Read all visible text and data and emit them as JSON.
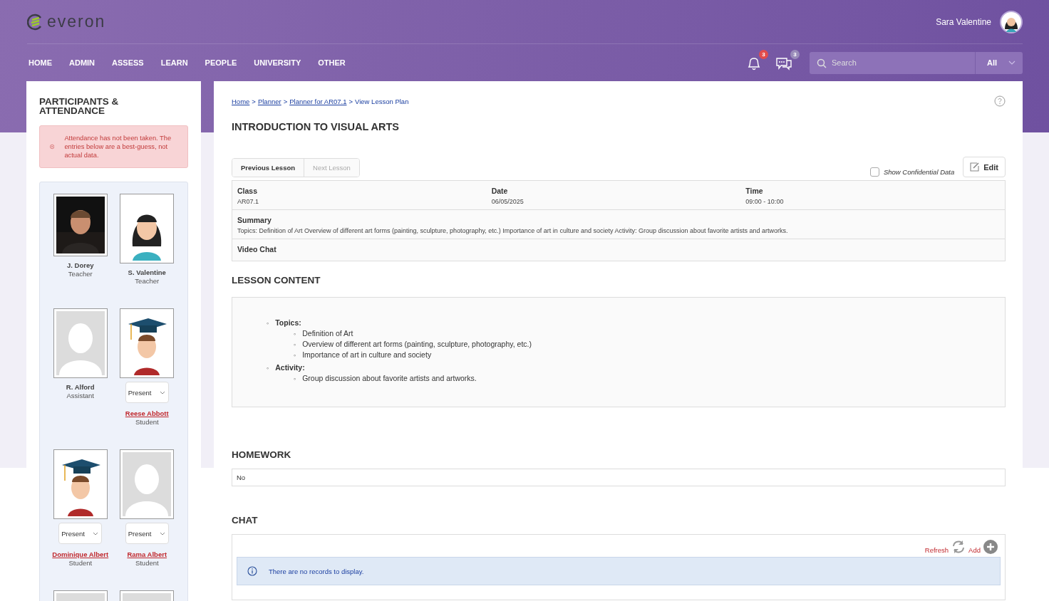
{
  "header": {
    "brand": "everon",
    "user_name": "Sara Valentine",
    "nav": [
      {
        "label": "HOME"
      },
      {
        "label": "ADMIN"
      },
      {
        "label": "ASSESS"
      },
      {
        "label": "LEARN"
      },
      {
        "label": "PEOPLE"
      },
      {
        "label": "UNIVERSITY"
      },
      {
        "label": "OTHER"
      }
    ],
    "notifications": "3",
    "messages": "3",
    "search": {
      "placeholder": "Search",
      "scope": "All"
    }
  },
  "participants": {
    "title": "PARTICIPANTS & ATTENDANCE",
    "alert": "Attendance has not been taken. The entries below are a best-guess, not actual data.",
    "people": [
      {
        "name": "J. Dorey",
        "role": "Teacher",
        "link": false
      },
      {
        "kind": "illustration",
        "name": "S. Valentine",
        "role": "Teacher",
        "link": false
      },
      {
        "kind": "placeholder",
        "name": "R. Alford",
        "role": "Assistant",
        "link": false
      },
      {
        "kind": "graduate",
        "attendance": "Present",
        "name": "Reese Abbott",
        "role": "Student",
        "link": true
      },
      {
        "kind": "graduate",
        "attendance": "Present",
        "name": "Dominique Albert",
        "role": "Student",
        "link": true
      },
      {
        "kind": "placeholder",
        "attendance": "Present",
        "name": "Rama Albert",
        "role": "Student",
        "link": true
      },
      {
        "kind": "placeholder"
      },
      {
        "kind": "placeholder"
      }
    ]
  },
  "main": {
    "breadcrumb": {
      "separator": ">",
      "links": [
        "Home",
        "Planner",
        "Planner for AR07.1"
      ],
      "current": "View Lesson Plan"
    },
    "title": "INTRODUCTION TO VISUAL ARTS",
    "lesson_nav": [
      {
        "label": "Previous Lesson",
        "disabled": false
      },
      {
        "label": "Next Lesson",
        "disabled": true
      }
    ],
    "show_confidential": {
      "label": "Show Confidential Data",
      "checked": false
    },
    "edit_button": "Edit",
    "details": [
      {
        "label": "Class",
        "value": "AR07.1"
      },
      {
        "label": "Date",
        "value": "06/05/2025"
      },
      {
        "label": "Time",
        "value": "09:00 - 10:00"
      }
    ],
    "summary": {
      "label": "Summary",
      "value": "Topics: Definition of Art Overview of different art forms (painting, sculpture, photography, etc.) Importance of art in culture and society Activity: Group discussion about favorite artists and artworks."
    },
    "video_chat": "Video Chat",
    "lesson_content": {
      "heading": "LESSON CONTENT",
      "marker": "◦",
      "items": [
        {
          "text": "Topics:",
          "children": [
            {
              "text": "Definition of Art"
            },
            {
              "text": "Overview of different art forms (painting, sculpture, photography, etc.)"
            },
            {
              "text": "Importance of art in culture and society"
            }
          ]
        },
        {
          "text": "Activity:",
          "children": [
            {
              "text": "Group discussion about favorite artists and artworks."
            }
          ]
        }
      ]
    },
    "homework": {
      "heading": "HOMEWORK",
      "value": "No"
    },
    "chat": {
      "heading": "CHAT",
      "refresh": "Refresh",
      "add": "Add",
      "empty": "There are no records to display."
    }
  }
}
